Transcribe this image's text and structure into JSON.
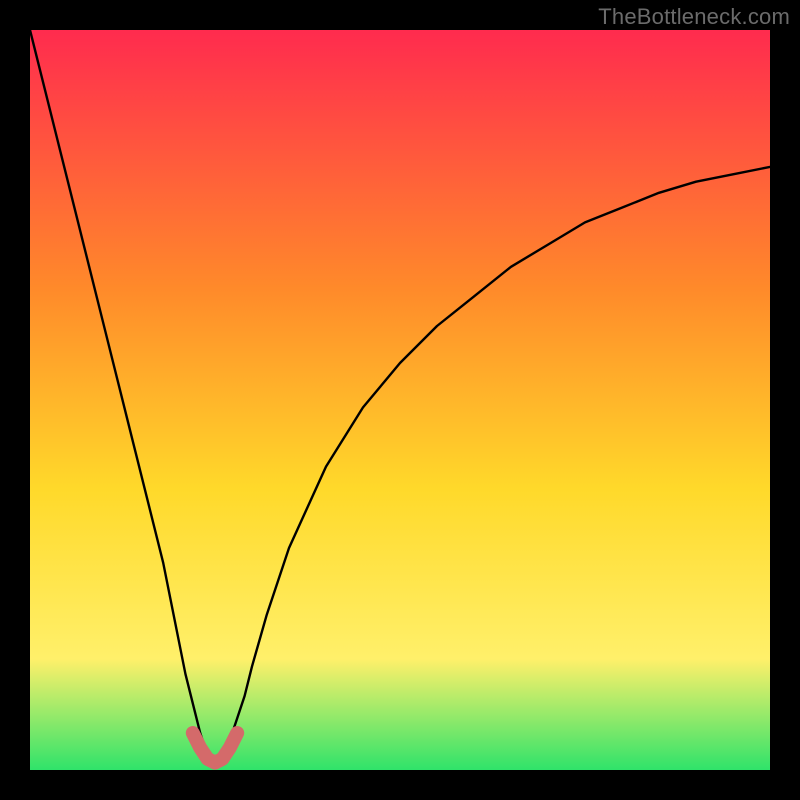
{
  "watermark": "TheBottleneck.com",
  "colors": {
    "frame": "#000000",
    "gradient_top": "#ff2b4e",
    "gradient_mid1": "#ff8a2a",
    "gradient_mid2": "#ffd92a",
    "gradient_mid3": "#fff06a",
    "gradient_bottom": "#2fe36a",
    "curve": "#000000",
    "highlight": "#d46a6a"
  },
  "chart_data": {
    "type": "line",
    "title": "",
    "xlabel": "",
    "ylabel": "",
    "xlim": [
      0,
      100
    ],
    "ylim": [
      0,
      100
    ],
    "notch_x": 25,
    "series": [
      {
        "name": "bottleneck-curve",
        "x": [
          0,
          2,
          4,
          6,
          8,
          10,
          12,
          14,
          16,
          18,
          20,
          21,
          22,
          23,
          24,
          25,
          26,
          27,
          28,
          29,
          30,
          32,
          35,
          40,
          45,
          50,
          55,
          60,
          65,
          70,
          75,
          80,
          85,
          90,
          95,
          100
        ],
        "y": [
          100,
          92,
          84,
          76,
          68,
          60,
          52,
          44,
          36,
          28,
          18,
          13,
          9,
          5,
          2,
          1,
          2,
          4,
          7,
          10,
          14,
          21,
          30,
          41,
          49,
          55,
          60,
          64,
          68,
          71,
          74,
          76,
          78,
          79.5,
          80.5,
          81.5
        ]
      },
      {
        "name": "notch-highlight",
        "x": [
          22,
          23,
          24,
          25,
          26,
          27,
          28
        ],
        "y": [
          5,
          3,
          1.5,
          1,
          1.5,
          3,
          5
        ]
      }
    ]
  }
}
